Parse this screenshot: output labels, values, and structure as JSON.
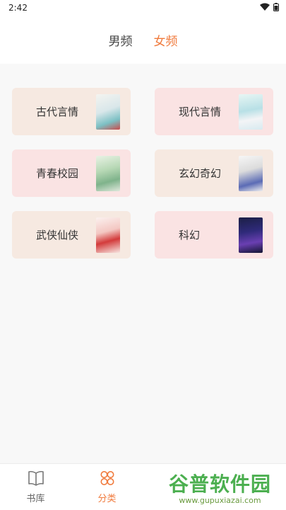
{
  "status_bar": {
    "time": "2:42",
    "icons": [
      "wifi-icon",
      "battery-icon"
    ]
  },
  "header": {
    "tabs": [
      {
        "label": "男频",
        "active": false
      },
      {
        "label": "女频",
        "active": true
      }
    ]
  },
  "categories": [
    {
      "label": "古代言情",
      "style": "beige",
      "cover": "c1"
    },
    {
      "label": "现代言情",
      "style": "pink",
      "cover": "c2"
    },
    {
      "label": "青春校园",
      "style": "pink",
      "cover": "c3"
    },
    {
      "label": "玄幻奇幻",
      "style": "beige",
      "cover": "c4"
    },
    {
      "label": "武侠仙侠",
      "style": "beige",
      "cover": "c5"
    },
    {
      "label": "科幻",
      "style": "pink",
      "cover": "c6"
    }
  ],
  "bottom_nav": {
    "items": [
      {
        "label": "书库",
        "icon": "book-icon",
        "active": false
      },
      {
        "label": "分类",
        "icon": "clover-icon",
        "active": true
      }
    ]
  },
  "watermark": {
    "text": "谷普软件园",
    "url": "www.gupuxiazai.com"
  },
  "colors": {
    "accent": "#f07a3c",
    "beige_card": "#f6e9e1",
    "pink_card": "#fae3e3"
  }
}
